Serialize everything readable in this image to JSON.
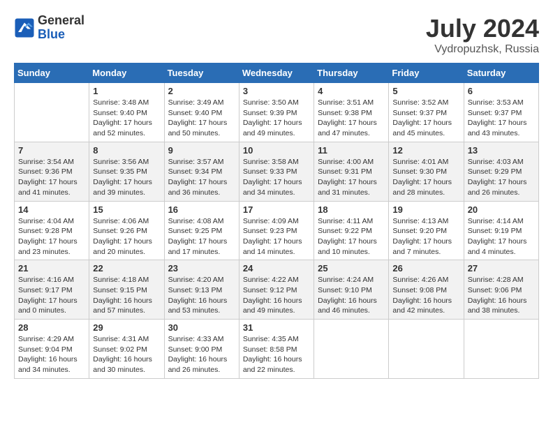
{
  "header": {
    "logo_general": "General",
    "logo_blue": "Blue",
    "month_title": "July 2024",
    "location": "Vydropuzhsk, Russia"
  },
  "calendar": {
    "days_of_week": [
      "Sunday",
      "Monday",
      "Tuesday",
      "Wednesday",
      "Thursday",
      "Friday",
      "Saturday"
    ],
    "weeks": [
      [
        {
          "day": "",
          "info": ""
        },
        {
          "day": "1",
          "info": "Sunrise: 3:48 AM\nSunset: 9:40 PM\nDaylight: 17 hours\nand 52 minutes."
        },
        {
          "day": "2",
          "info": "Sunrise: 3:49 AM\nSunset: 9:40 PM\nDaylight: 17 hours\nand 50 minutes."
        },
        {
          "day": "3",
          "info": "Sunrise: 3:50 AM\nSunset: 9:39 PM\nDaylight: 17 hours\nand 49 minutes."
        },
        {
          "day": "4",
          "info": "Sunrise: 3:51 AM\nSunset: 9:38 PM\nDaylight: 17 hours\nand 47 minutes."
        },
        {
          "day": "5",
          "info": "Sunrise: 3:52 AM\nSunset: 9:37 PM\nDaylight: 17 hours\nand 45 minutes."
        },
        {
          "day": "6",
          "info": "Sunrise: 3:53 AM\nSunset: 9:37 PM\nDaylight: 17 hours\nand 43 minutes."
        }
      ],
      [
        {
          "day": "7",
          "info": "Sunrise: 3:54 AM\nSunset: 9:36 PM\nDaylight: 17 hours\nand 41 minutes."
        },
        {
          "day": "8",
          "info": "Sunrise: 3:56 AM\nSunset: 9:35 PM\nDaylight: 17 hours\nand 39 minutes."
        },
        {
          "day": "9",
          "info": "Sunrise: 3:57 AM\nSunset: 9:34 PM\nDaylight: 17 hours\nand 36 minutes."
        },
        {
          "day": "10",
          "info": "Sunrise: 3:58 AM\nSunset: 9:33 PM\nDaylight: 17 hours\nand 34 minutes."
        },
        {
          "day": "11",
          "info": "Sunrise: 4:00 AM\nSunset: 9:31 PM\nDaylight: 17 hours\nand 31 minutes."
        },
        {
          "day": "12",
          "info": "Sunrise: 4:01 AM\nSunset: 9:30 PM\nDaylight: 17 hours\nand 28 minutes."
        },
        {
          "day": "13",
          "info": "Sunrise: 4:03 AM\nSunset: 9:29 PM\nDaylight: 17 hours\nand 26 minutes."
        }
      ],
      [
        {
          "day": "14",
          "info": "Sunrise: 4:04 AM\nSunset: 9:28 PM\nDaylight: 17 hours\nand 23 minutes."
        },
        {
          "day": "15",
          "info": "Sunrise: 4:06 AM\nSunset: 9:26 PM\nDaylight: 17 hours\nand 20 minutes."
        },
        {
          "day": "16",
          "info": "Sunrise: 4:08 AM\nSunset: 9:25 PM\nDaylight: 17 hours\nand 17 minutes."
        },
        {
          "day": "17",
          "info": "Sunrise: 4:09 AM\nSunset: 9:23 PM\nDaylight: 17 hours\nand 14 minutes."
        },
        {
          "day": "18",
          "info": "Sunrise: 4:11 AM\nSunset: 9:22 PM\nDaylight: 17 hours\nand 10 minutes."
        },
        {
          "day": "19",
          "info": "Sunrise: 4:13 AM\nSunset: 9:20 PM\nDaylight: 17 hours\nand 7 minutes."
        },
        {
          "day": "20",
          "info": "Sunrise: 4:14 AM\nSunset: 9:19 PM\nDaylight: 17 hours\nand 4 minutes."
        }
      ],
      [
        {
          "day": "21",
          "info": "Sunrise: 4:16 AM\nSunset: 9:17 PM\nDaylight: 17 hours\nand 0 minutes."
        },
        {
          "day": "22",
          "info": "Sunrise: 4:18 AM\nSunset: 9:15 PM\nDaylight: 16 hours\nand 57 minutes."
        },
        {
          "day": "23",
          "info": "Sunrise: 4:20 AM\nSunset: 9:13 PM\nDaylight: 16 hours\nand 53 minutes."
        },
        {
          "day": "24",
          "info": "Sunrise: 4:22 AM\nSunset: 9:12 PM\nDaylight: 16 hours\nand 49 minutes."
        },
        {
          "day": "25",
          "info": "Sunrise: 4:24 AM\nSunset: 9:10 PM\nDaylight: 16 hours\nand 46 minutes."
        },
        {
          "day": "26",
          "info": "Sunrise: 4:26 AM\nSunset: 9:08 PM\nDaylight: 16 hours\nand 42 minutes."
        },
        {
          "day": "27",
          "info": "Sunrise: 4:28 AM\nSunset: 9:06 PM\nDaylight: 16 hours\nand 38 minutes."
        }
      ],
      [
        {
          "day": "28",
          "info": "Sunrise: 4:29 AM\nSunset: 9:04 PM\nDaylight: 16 hours\nand 34 minutes."
        },
        {
          "day": "29",
          "info": "Sunrise: 4:31 AM\nSunset: 9:02 PM\nDaylight: 16 hours\nand 30 minutes."
        },
        {
          "day": "30",
          "info": "Sunrise: 4:33 AM\nSunset: 9:00 PM\nDaylight: 16 hours\nand 26 minutes."
        },
        {
          "day": "31",
          "info": "Sunrise: 4:35 AM\nSunset: 8:58 PM\nDaylight: 16 hours\nand 22 minutes."
        },
        {
          "day": "",
          "info": ""
        },
        {
          "day": "",
          "info": ""
        },
        {
          "day": "",
          "info": ""
        }
      ]
    ]
  }
}
